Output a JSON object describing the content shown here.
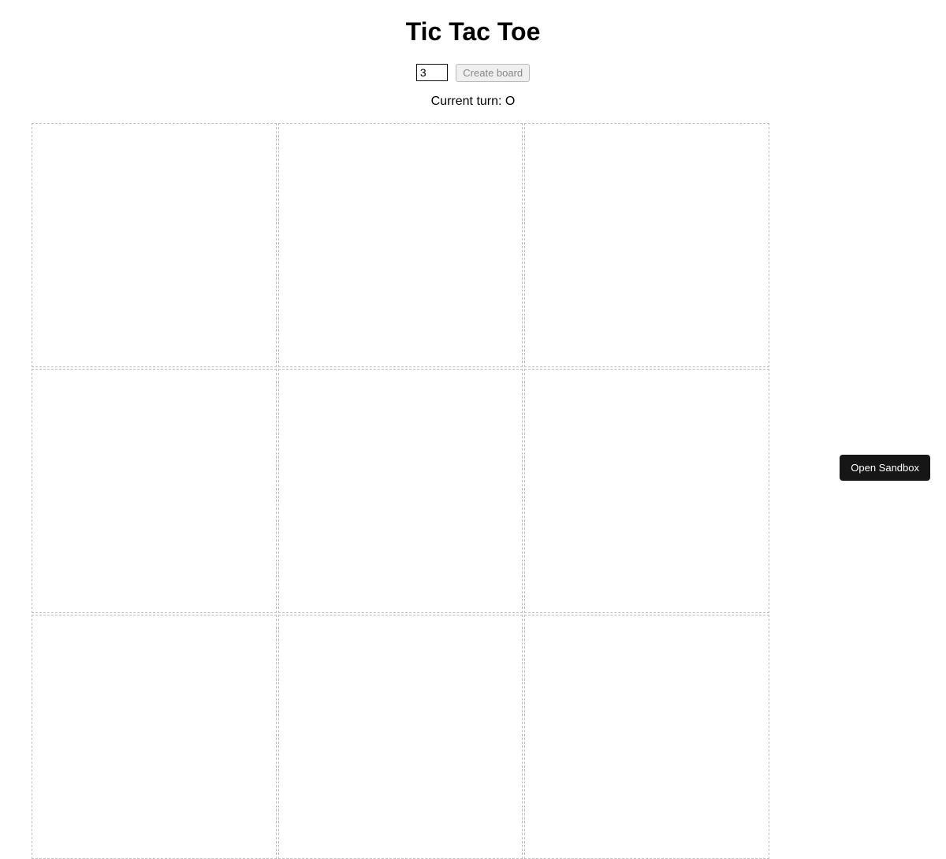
{
  "title": "Tic Tac Toe",
  "controls": {
    "size_value": "3",
    "create_label": "Create board"
  },
  "status": {
    "turn_prefix": "Current turn: ",
    "turn_player": "O"
  },
  "board": {
    "size": 3,
    "cells": [
      "",
      "",
      "",
      "",
      "",
      "",
      "",
      "",
      ""
    ]
  },
  "sandbox": {
    "open_label": "Open Sandbox"
  }
}
